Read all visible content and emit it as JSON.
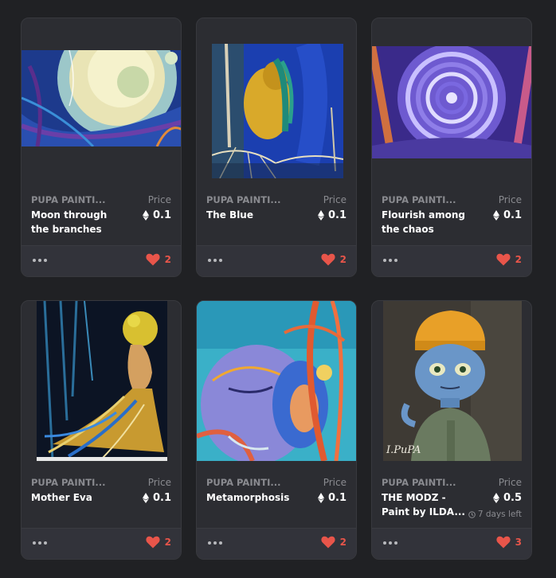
{
  "cards": [
    {
      "collection": "PUPA PAINTI...",
      "title": "Moon through the branches",
      "price_label": "Price",
      "price": "0.1",
      "likes": "2",
      "time_left": ""
    },
    {
      "collection": "PUPA PAINTI...",
      "title": "The Blue",
      "price_label": "Price",
      "price": "0.1",
      "likes": "2",
      "time_left": ""
    },
    {
      "collection": "PUPA PAINTI...",
      "title": "Flourish among the chaos",
      "price_label": "Price",
      "price": "0.1",
      "likes": "2",
      "time_left": ""
    },
    {
      "collection": "PUPA PAINTI...",
      "title": "Mother Eva",
      "price_label": "Price",
      "price": "0.1",
      "likes": "2",
      "time_left": ""
    },
    {
      "collection": "PUPA PAINTI...",
      "title": "Metamorphosis",
      "price_label": "Price",
      "price": "0.1",
      "likes": "2",
      "time_left": ""
    },
    {
      "collection": "PUPA PAINTI...",
      "title": "THE MODZ - Paint by ILDA...",
      "price_label": "Price",
      "price": "0.5",
      "likes": "3",
      "time_left": "7 days left",
      "signature": "I.PuPA"
    }
  ],
  "colors": {
    "background": "#202124",
    "card": "#2c2d32",
    "like": "#e8554a",
    "muted": "#8a8b90"
  },
  "icons": {
    "more": "more-dots-icon",
    "like": "heart-icon",
    "currency": "ethereum-icon",
    "time": "clock-icon"
  }
}
